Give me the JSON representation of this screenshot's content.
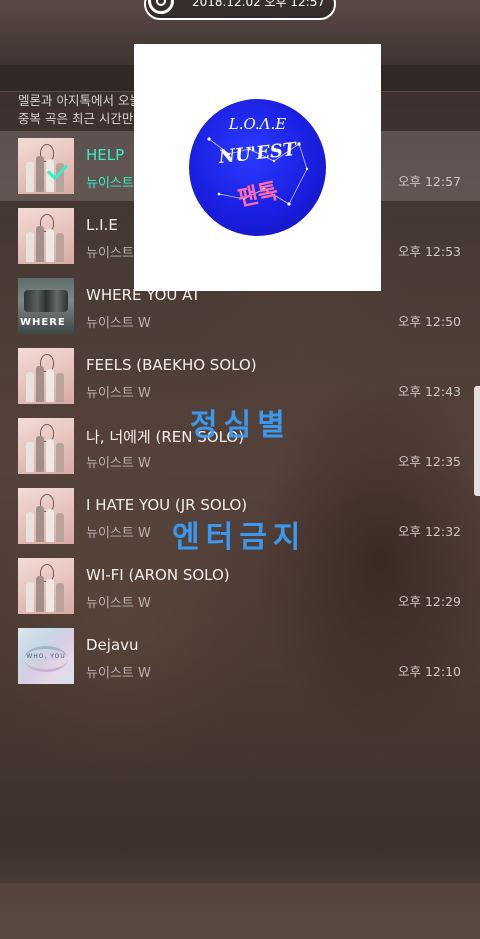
{
  "status": {
    "timestamp": "2018.12.02 오후 12:57"
  },
  "info": {
    "line1": "멜론과 아지톡에서 오늘",
    "line2": "중복 곡은 최근 시간만"
  },
  "songs": [
    {
      "title": "HELP",
      "artist": "뉴이스트",
      "time": "오후 12:57",
      "cover": "wanna",
      "selected": true
    },
    {
      "title": "L.I.E",
      "artist": "뉴이스트 W",
      "time": "오후 12:53",
      "cover": "wanna"
    },
    {
      "title": "WHERE YOU AT",
      "artist": "뉴이스트 W",
      "time": "오후 12:50",
      "cover": "where"
    },
    {
      "title": "FEELS (BAEKHO SOLO)",
      "artist": "뉴이스트 W",
      "time": "오후 12:43",
      "cover": "wanna"
    },
    {
      "title": "나, 너에게 (REN SOLO)",
      "artist": "뉴이스트 W",
      "time": "오후 12:35",
      "cover": "wanna"
    },
    {
      "title": "I HATE YOU (JR SOLO)",
      "artist": "뉴이스트 W",
      "time": "오후 12:32",
      "cover": "wanna"
    },
    {
      "title": "WI-FI (ARON SOLO)",
      "artist": "뉴이스트 W",
      "time": "오후 12:29",
      "cover": "wanna"
    },
    {
      "title": "Dejavu",
      "artist": "뉴이스트 W",
      "time": "오후 12:10",
      "cover": "dejavu"
    }
  ],
  "covers": {
    "where_word": "WHERE",
    "dejavu_word": "WHO, YOU"
  },
  "popup": {
    "line1": "L.O.Λ.E",
    "line2": "NU'EST",
    "line3": "팬톡"
  },
  "overlay": {
    "text1": "정심별",
    "text2": "엔터금지"
  },
  "colors": {
    "accent": "#36f0c4",
    "overlay": "#3aa0ff",
    "badge": "#1a1fe0"
  }
}
